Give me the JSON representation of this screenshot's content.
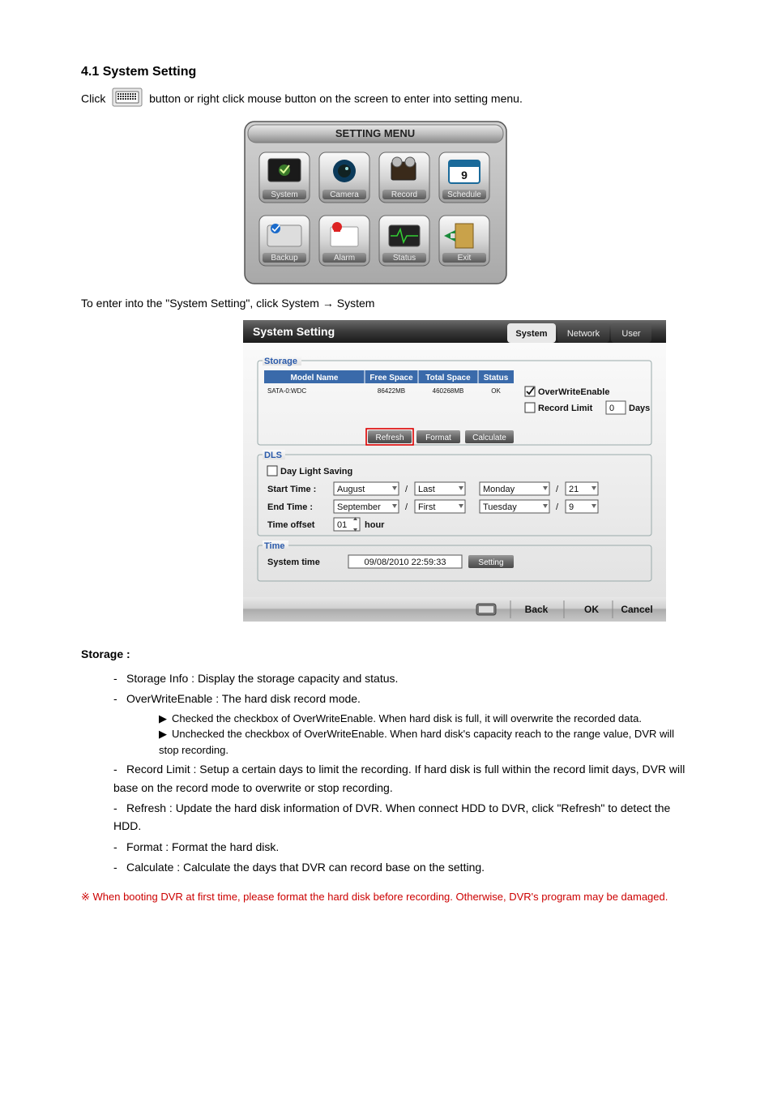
{
  "heading_system_setting": "4.1 System Setting",
  "intro_line1_a": "Click ",
  "intro_line1_b": " button or right click mouse button on the screen to enter into setting menu.",
  "intro_line2": "To enter into the \"System Setting\", click System → System",
  "setting_menu": {
    "title": "SETTING MENU",
    "items": [
      "System",
      "Camera",
      "Record",
      "Schedule",
      "Backup",
      "Alarm",
      "Status",
      "Exit"
    ]
  },
  "system_panel": {
    "title": "System Setting",
    "tabs": [
      "System",
      "Network",
      "User"
    ],
    "storage": {
      "legend": "Storage",
      "columns": [
        "Model Name",
        "Free Space",
        "Total Space",
        "Status"
      ],
      "row": {
        "model": "SATA-0:WDC",
        "free": "86422MB",
        "total": "460268MB",
        "status": "OK"
      },
      "overwrite_label": "OverWriteEnable",
      "recordlimit_label": "Record Limit",
      "recordlimit_value": "0",
      "recordlimit_unit": "Days",
      "btn_refresh": "Refresh",
      "btn_format": "Format",
      "btn_calc": "Calculate"
    },
    "dls": {
      "legend": "DLS",
      "checkbox": "Day Light Saving",
      "start_label": "Start  Time :",
      "end_label": "End   Time :",
      "offset_label": "Time offset",
      "start_month": "August",
      "start_week": "Last",
      "start_day": "Monday",
      "start_num": "21",
      "end_month": "September",
      "end_week": "First",
      "end_day": "Tuesday",
      "end_num": "9",
      "offset_val": "01",
      "offset_unit": "hour"
    },
    "time": {
      "legend": "Time",
      "label": "System time",
      "value": "09/08/2010 22:59:33",
      "btn": "Setting"
    },
    "footer": {
      "back": "Back",
      "ok": "OK",
      "cancel": "Cancel"
    }
  },
  "storage_section": {
    "title": "Storage :",
    "item1": "Storage Info : Display the storage capacity and status.",
    "item2": "OverWriteEnable : The hard disk record mode.",
    "item2a": "Checked the checkbox of OverWriteEnable. When hard disk is full, it will overwrite the recorded data.",
    "item2b": "Unchecked the checkbox of OverWriteEnable. When hard disk's capacity reach to the range value, DVR will stop recording.",
    "item3": "Record Limit : Setup a certain days to limit the recording. If hard disk is full within the record limit days, DVR will base on the record mode to overwrite or stop recording.",
    "item4": "Refresh : Update the hard disk information of DVR. When connect HDD to DVR, click \"Refresh\" to detect the HDD.",
    "item5": "Format : Format the hard disk.",
    "item6": "Calculate : Calculate the days that DVR can record base on the setting.",
    "note": "※ When booting DVR at first time, please format the hard disk before recording. Otherwise, DVR's program may be damaged."
  }
}
